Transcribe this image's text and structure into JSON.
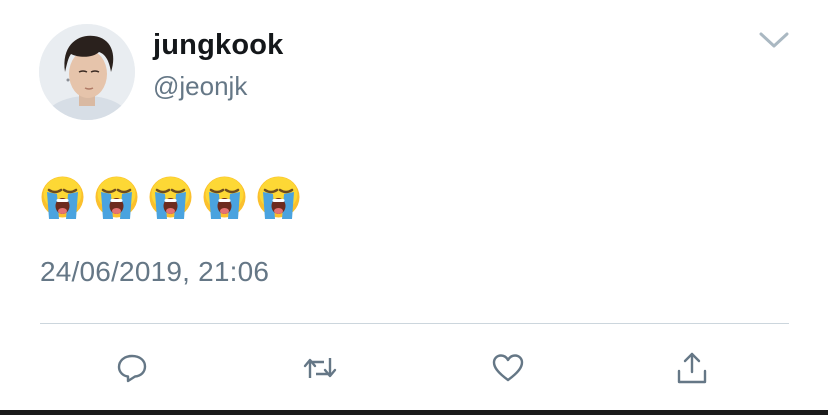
{
  "tweet": {
    "author": {
      "display_name": "jungkook",
      "handle": "@jeonjk",
      "avatar": "profile-photo"
    },
    "text_emoji": [
      "loudly-crying-face",
      "loudly-crying-face",
      "loudly-crying-face",
      "loudly-crying-face",
      "loudly-crying-face"
    ],
    "text": "😭😭😭😭😭",
    "timestamp": "24/06/2019, 21:06"
  },
  "actions": [
    {
      "name": "reply",
      "icon": "reply-icon"
    },
    {
      "name": "retweet",
      "icon": "retweet-icon"
    },
    {
      "name": "like",
      "icon": "heart-icon"
    },
    {
      "name": "share",
      "icon": "share-icon"
    }
  ],
  "colors": {
    "primary_text": "#14171a",
    "secondary_text": "#657786",
    "divider": "#ccd6dd",
    "icon": "#657786",
    "emoji_face": "#fbc02d",
    "emoji_tears": "#4aa3df"
  }
}
